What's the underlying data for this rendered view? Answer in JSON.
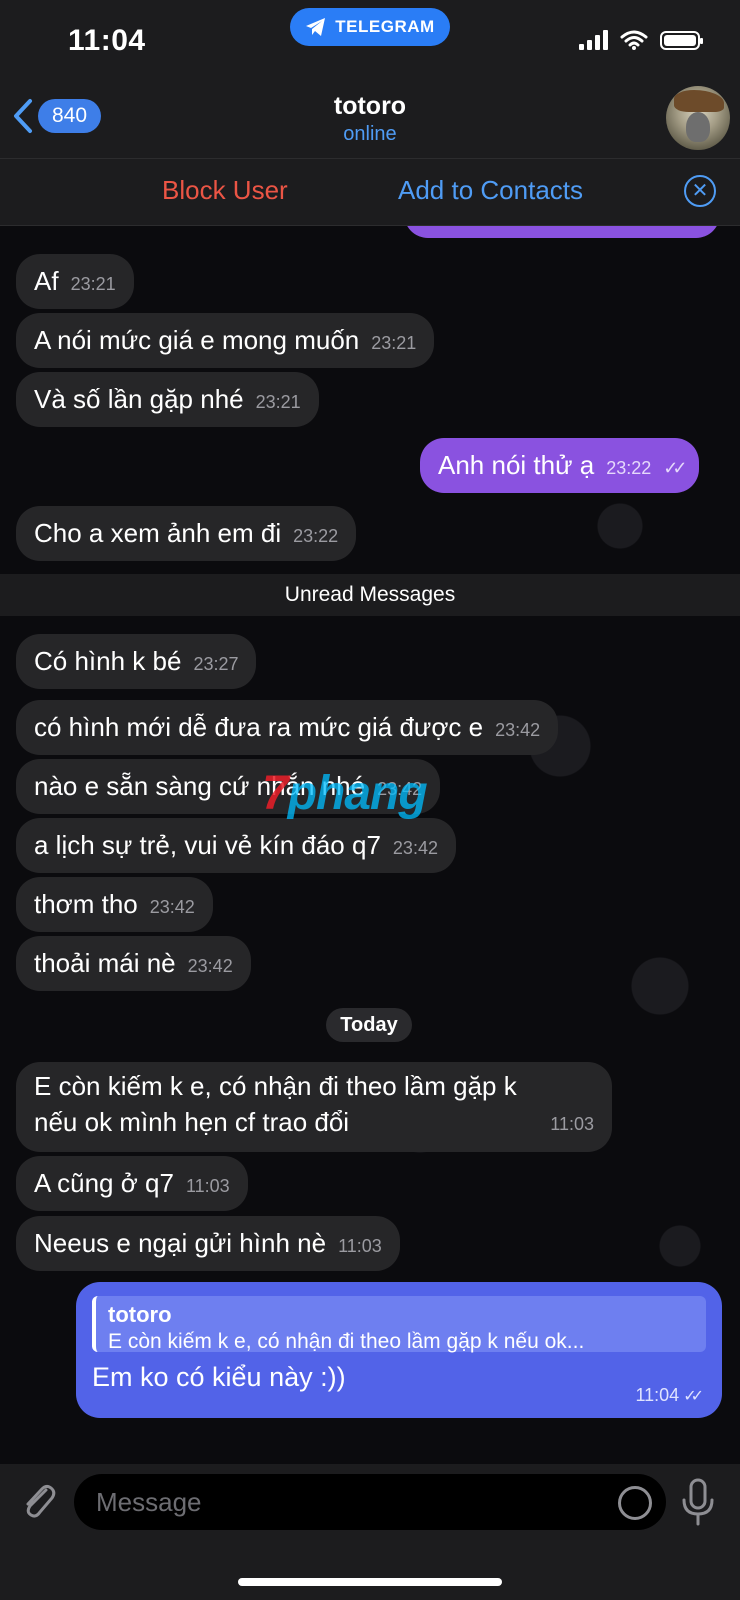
{
  "status": {
    "time": "11:04",
    "app_pill": "TELEGRAM"
  },
  "header": {
    "back_count": "840",
    "title": "totoro",
    "subtitle": "online"
  },
  "actions": {
    "block": "Block User",
    "add": "Add to Contacts"
  },
  "messages": [
    {
      "text": "Af",
      "time": "23:21"
    },
    {
      "text": "A nói mức giá e mong muốn",
      "time": "23:21"
    },
    {
      "text": "Và số lần gặp nhé",
      "time": "23:21"
    },
    {
      "text": "Anh nói thử ạ",
      "time": "23:22"
    },
    {
      "text": "Cho a xem ảnh em đi",
      "time": "23:22"
    },
    {
      "text": "Có hình k bé",
      "time": "23:27"
    },
    {
      "text": "có hình mới dễ đưa ra mức giá được e",
      "time": "23:42"
    },
    {
      "text": "nào e sẵn sàng cứ nhắn nhé",
      "time": "23:42"
    },
    {
      "text": "a lịch sự trẻ, vui vẻ kín đáo q7",
      "time": "23:42"
    },
    {
      "text": "thơm tho",
      "time": "23:42"
    },
    {
      "text": "thoải mái nè",
      "time": "23:42"
    },
    {
      "text_line1": "E còn kiếm k e, có nhận đi theo lầm gặp k",
      "text_line2": "nếu ok mình hẹn cf trao đổi",
      "time": "11:03"
    },
    {
      "text": "A cũng ở q7",
      "time": "11:03"
    },
    {
      "text": "Neeus e ngại gửi hình nè",
      "time": "11:03"
    }
  ],
  "unread_label": "Unread Messages",
  "date_label": "Today",
  "reply": {
    "quote_name": "totoro",
    "quote_text": "E còn kiếm k e, có nhận đi theo lầm gặp k nếu ok...",
    "text": "Em ko có kiểu này :))",
    "time": "11:04"
  },
  "watermark": {
    "red": "7",
    "blue": "phang"
  },
  "composer": {
    "placeholder": "Message"
  },
  "colors": {
    "accent": "#4f9cf5",
    "outgoing": "#8a52e0",
    "reply_bubble": "#5263e8",
    "block": "#eb5545"
  }
}
